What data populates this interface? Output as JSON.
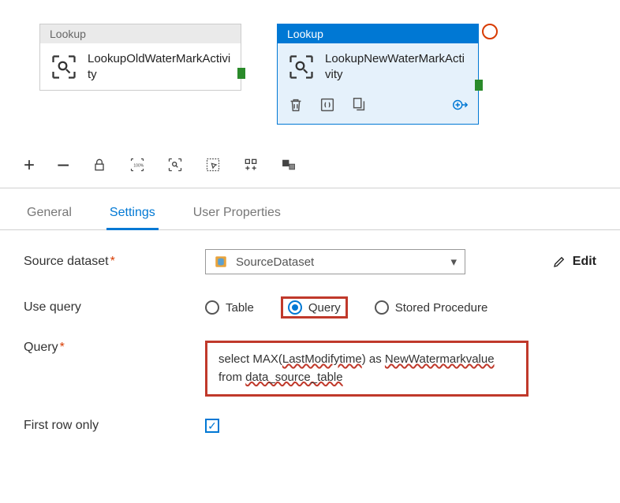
{
  "canvas": {
    "activity1": {
      "type_label": "Lookup",
      "name": "LookupOldWaterMarkActivity"
    },
    "activity2": {
      "type_label": "Lookup",
      "name": "LookupNewWaterMarkActivity"
    }
  },
  "tabs": {
    "general": "General",
    "settings": "Settings",
    "user_properties": "User Properties"
  },
  "settings": {
    "source_dataset_label": "Source dataset",
    "source_dataset_value": "SourceDataset",
    "edit_label": "Edit",
    "use_query_label": "Use query",
    "radio_table": "Table",
    "radio_query": "Query",
    "radio_sp": "Stored Procedure",
    "query_label": "Query",
    "query_text_prefix": "select MAX(",
    "query_text_s1": "LastModifytime",
    "query_text_mid1": ") as ",
    "query_text_s2": "NewWatermarkvalue",
    "query_text_mid2": " from ",
    "query_text_s3": "data_source_table",
    "first_row_label": "First row only"
  }
}
